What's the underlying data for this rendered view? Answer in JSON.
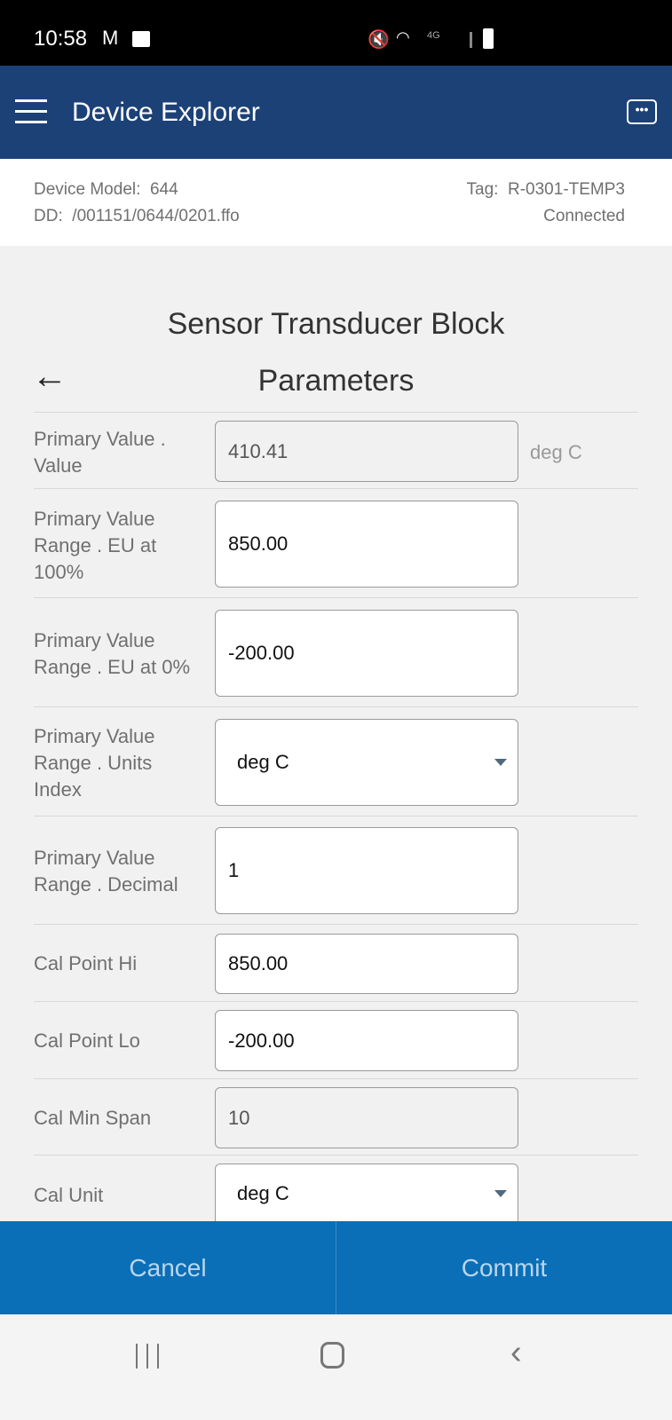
{
  "status_bar": {
    "time": "10:58",
    "icons": [
      "gmail-icon",
      "image-icon",
      "mute-icon",
      "wifi-icon",
      "4g-icon",
      "signal-icon",
      "battery-icon"
    ]
  },
  "app_bar": {
    "title": "Device Explorer",
    "menu_icon": "hamburger-icon",
    "chat_icon": "chat-bubble-icon",
    "color": "#1c4177"
  },
  "device_info": {
    "model_label": "Device Model:",
    "model": "644",
    "dd_label": "DD:",
    "dd": "/001151/0644/0201.ffo",
    "tag_label": "Tag:",
    "tag": "R-0301-TEMP3",
    "connection": "Connected"
  },
  "block_title": "Sensor Transducer Block",
  "section_title": "Parameters",
  "params": [
    {
      "label": "Primary Value . Value",
      "value": "410.41",
      "unit": "deg C",
      "readonly": true
    },
    {
      "label": "Primary Value Range . EU at 100%",
      "value": "850.00"
    },
    {
      "label": "Primary Value Range . EU at 0%",
      "value": "-200.00"
    },
    {
      "label": "Primary Value Range . Units Index",
      "value": "deg C",
      "type": "dropdown"
    },
    {
      "label": "Primary Value Range . Decimal",
      "value": "1"
    },
    {
      "label": "Cal Point Hi",
      "value": "850.00"
    },
    {
      "label": "Cal Point Lo",
      "value": "-200.00"
    },
    {
      "label": "Cal Min Span",
      "value": "10",
      "readonly": true
    },
    {
      "label": "Cal Unit",
      "value": "deg C",
      "type": "dropdown"
    }
  ],
  "actions": {
    "cancel": "Cancel",
    "commit": "Commit",
    "color": "#0a6fb7"
  }
}
